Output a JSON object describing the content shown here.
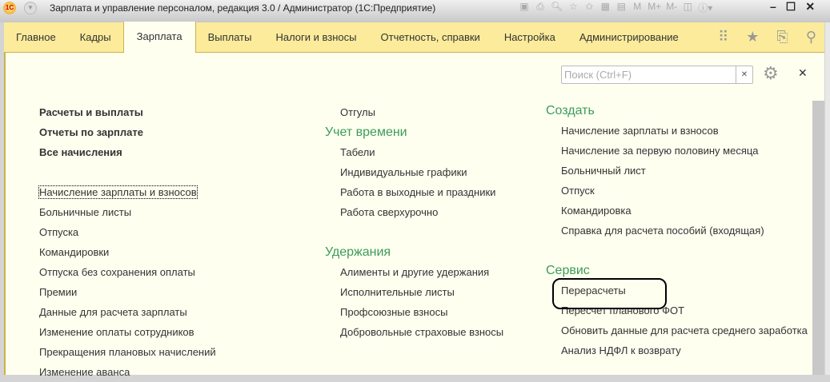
{
  "window": {
    "title": "Зарплата и управление персоналом, редакция 3.0 / Администратор  (1С:Предприятие)",
    "logo": "1С",
    "toolbar_icons": [
      "save-icon",
      "print-icon",
      "preview-icon",
      "favorite-add-icon",
      "bookmark-icon",
      "calculator-icon",
      "calendar-icon",
      "M",
      "M+",
      "M-",
      "panel-icon",
      "info-icon"
    ],
    "controls": [
      "minimize",
      "maximize",
      "close"
    ]
  },
  "nav": {
    "tabs": [
      "Главное",
      "Кадры",
      "Зарплата",
      "Выплаты",
      "Налоги и взносы",
      "Отчетность, справки",
      "Настройка",
      "Администрирование"
    ],
    "active": "Зарплата",
    "icons": [
      "apps-icon",
      "star-icon",
      "history-icon",
      "search-icon"
    ]
  },
  "search": {
    "placeholder": "Поиск (Ctrl+F)",
    "value": ""
  },
  "col1": {
    "bold": [
      "Расчеты и выплаты",
      "Отчеты по зарплате",
      "Все начисления"
    ],
    "items": [
      "Начисление зарплаты и взносов",
      "Больничные листы",
      "Отпуска",
      "Командировки",
      "Отпуска без сохранения оплаты",
      "Премии",
      "Данные для расчета зарплаты",
      "Изменение оплаты сотрудников",
      "Прекращения плановых начислений",
      "Изменение аванса"
    ]
  },
  "col2": {
    "top": [
      "Отгулы"
    ],
    "sections": [
      {
        "title": "Учет времени",
        "items": [
          "Табели",
          "Индивидуальные графики",
          "Работа в выходные и праздники",
          "Работа сверхурочно"
        ]
      },
      {
        "title": "Удержания",
        "items": [
          "Алименты и другие удержания",
          "Исполнительные листы",
          "Профсоюзные взносы",
          "Добровольные страховые взносы"
        ]
      }
    ]
  },
  "col3": {
    "sections": [
      {
        "title": "Создать",
        "items": [
          "Начисление зарплаты и взносов",
          "Начисление за первую половину месяца",
          "Больничный лист",
          "Отпуск",
          "Командировка",
          "Справка для расчета пособий (входящая)"
        ]
      },
      {
        "title": "Сервис",
        "items": [
          "Перерасчеты",
          "Пересчет планового ФОТ",
          "Обновить данные для расчета среднего заработка",
          "Анализ НДФЛ к возврату"
        ]
      }
    ]
  },
  "colors": {
    "nav_bg": "#fbeb9b",
    "content_bg": "#fffff0",
    "section_header": "#3b9c5a"
  }
}
